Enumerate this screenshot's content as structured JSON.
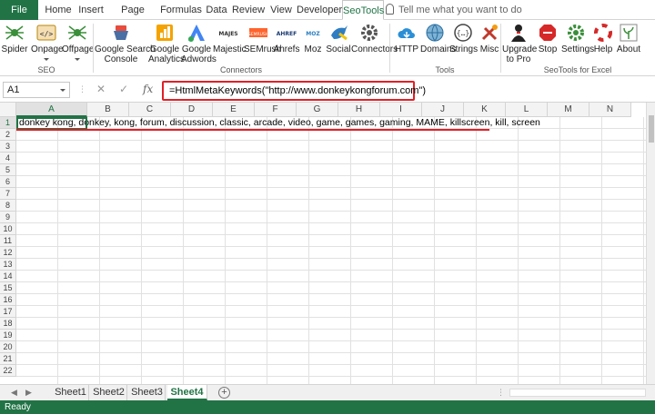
{
  "tabs": [
    "File",
    "Home",
    "Insert",
    "Page Layout",
    "Formulas",
    "Data",
    "Review",
    "View",
    "Developer",
    "SeoTools"
  ],
  "tell_me": "Tell me what you want to do",
  "ribbon": {
    "buttons": [
      {
        "label1": "Spider",
        "label2": "",
        "icon": "spider-icon",
        "color": "#3a8f3a"
      },
      {
        "label1": "Onpage",
        "label2": "",
        "icon": "onpage-icon",
        "color": "#b8860b"
      },
      {
        "label1": "Offpage",
        "label2": "",
        "icon": "offpage-icon",
        "color": "#3a8f3a"
      },
      {
        "label1": "Google Search",
        "label2": "Console",
        "icon": "google-search-console-icon",
        "color": "#4a6fa5"
      },
      {
        "label1": "Google",
        "label2": "Analytics",
        "icon": "google-analytics-icon",
        "color": "#f4a300"
      },
      {
        "label1": "Google",
        "label2": "Adwords",
        "icon": "google-adwords-icon",
        "color": "#4285f4"
      },
      {
        "label1": "Majestic",
        "label2": "",
        "icon": "majestic-icon",
        "color": "#333"
      },
      {
        "label1": "SEMrush",
        "label2": "",
        "icon": "semrush-icon",
        "color": "#ff642d"
      },
      {
        "label1": "Ahrefs",
        "label2": "",
        "icon": "ahrefs-icon",
        "color": "#1a3b73"
      },
      {
        "label1": "Moz",
        "label2": "",
        "icon": "moz-icon",
        "color": "#2b7fc0"
      },
      {
        "label1": "Social",
        "label2": "",
        "icon": "social-icon",
        "color": "#2f7dc2"
      },
      {
        "label1": "Connectors",
        "label2": "",
        "icon": "connectors-icon",
        "color": "#555"
      },
      {
        "label1": "HTTP",
        "label2": "",
        "icon": "http-icon",
        "color": "#2b8fd6"
      },
      {
        "label1": "Domains",
        "label2": "",
        "icon": "domains-icon",
        "color": "#2b6ea0"
      },
      {
        "label1": "Strings",
        "label2": "",
        "icon": "strings-icon",
        "color": "#444"
      },
      {
        "label1": "Misc",
        "label2": "",
        "icon": "misc-icon",
        "color": "#c0392b"
      },
      {
        "label1": "Upgrade",
        "label2": "to Pro",
        "icon": "upgrade-icon",
        "color": "#222"
      },
      {
        "label1": "Stop",
        "label2": "",
        "icon": "stop-icon",
        "color": "#d62828"
      },
      {
        "label1": "Settings",
        "label2": "",
        "icon": "settings-icon",
        "color": "#3a8f3a"
      },
      {
        "label1": "Help",
        "label2": "",
        "icon": "help-icon",
        "color": "#d62828"
      },
      {
        "label1": "About",
        "label2": "",
        "icon": "about-icon",
        "color": "#3a8f3a"
      }
    ],
    "groups": [
      "SEO",
      "Connectors",
      "Tools",
      "SeoTools for Excel"
    ]
  },
  "formula_bar": {
    "name_box": "A1",
    "cancel_icon": "✕",
    "enter_icon": "✓",
    "fx_label": "fx",
    "formula": "=HtmlMetaKeywords(\"http://www.donkeykongforum.com\")"
  },
  "grid": {
    "columns": [
      "A",
      "B",
      "C",
      "D",
      "E",
      "F",
      "G",
      "H",
      "I",
      "J",
      "K",
      "L",
      "M",
      "N"
    ],
    "rows": [
      "1",
      "2",
      "3",
      "4",
      "5",
      "6",
      "7",
      "8",
      "9",
      "10",
      "11",
      "12",
      "13",
      "14",
      "15",
      "16",
      "17",
      "18",
      "19",
      "20",
      "21",
      "22"
    ],
    "a1_value": "donkey kong, donkey, kong, forum, discussion, classic, arcade, video, game, games, gaming, MAME, killscreen, kill, screen"
  },
  "sheets": [
    "Sheet1",
    "Sheet2",
    "Sheet3",
    "Sheet4"
  ],
  "active_sheet": "Sheet4",
  "status": "Ready",
  "colors": {
    "excel_green": "#217346",
    "highlight_red": "#e21f26"
  }
}
